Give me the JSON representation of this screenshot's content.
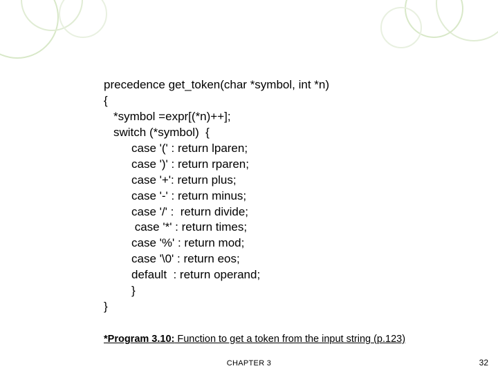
{
  "code": {
    "l0": "precedence get_token(char *symbol, int *n)",
    "l1": "{",
    "l2": "*symbol =expr[(*n)++];",
    "l3": "switch (*symbol)  {",
    "l4": "case '(' : return lparen;",
    "l5": "case ')' : return rparen;",
    "l6": "case '+': return plus;",
    "l7": "case '-' : return minus;",
    "l8": "case '/' :  return divide;",
    "l9": " case '*' : return times;",
    "l10": "case '%' : return mod;",
    "l11": "case '\\0' : return eos;",
    "l12": "default  : return operand;",
    "l13": "}",
    "l14": "}"
  },
  "caption": {
    "label": "*Program 3.10:",
    "text": " Function to get a token from the input string (p.123)"
  },
  "footer": {
    "chapter": "CHAPTER 3",
    "page": "32"
  }
}
